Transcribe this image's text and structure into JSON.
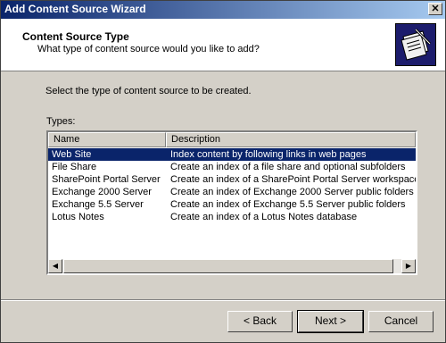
{
  "window": {
    "title": "Add Content Source Wizard",
    "close_glyph": "✕"
  },
  "header": {
    "title": "Content Source Type",
    "subtitle": "What type of content source would you like to add?",
    "icon": "wizard-document-icon"
  },
  "main": {
    "instruction": "Select the type of content source to be created.",
    "types_label": "Types:",
    "columns": [
      "Name",
      "Description"
    ],
    "rows": [
      {
        "name": "Web Site",
        "description": "Index content by following links in web pages",
        "selected": true
      },
      {
        "name": "File Share",
        "description": "Create an index of a file share and optional subfolders",
        "selected": false
      },
      {
        "name": "SharePoint Portal Server",
        "description": "Create an index of a SharePoint Portal Server workspace",
        "selected": false
      },
      {
        "name": "Exchange 2000 Server",
        "description": "Create an index of Exchange 2000 Server public folders",
        "selected": false
      },
      {
        "name": "Exchange 5.5 Server",
        "description": "Create an index of Exchange 5.5 Server public folders",
        "selected": false
      },
      {
        "name": "Lotus Notes",
        "description": "Create an index of a Lotus Notes database",
        "selected": false
      }
    ]
  },
  "buttons": {
    "back": "< Back",
    "next": "Next >",
    "cancel": "Cancel"
  },
  "colors": {
    "selection": "#0a246a",
    "titlebar_start": "#0a246a",
    "titlebar_end": "#a6caf0",
    "face": "#d4d0c8"
  }
}
